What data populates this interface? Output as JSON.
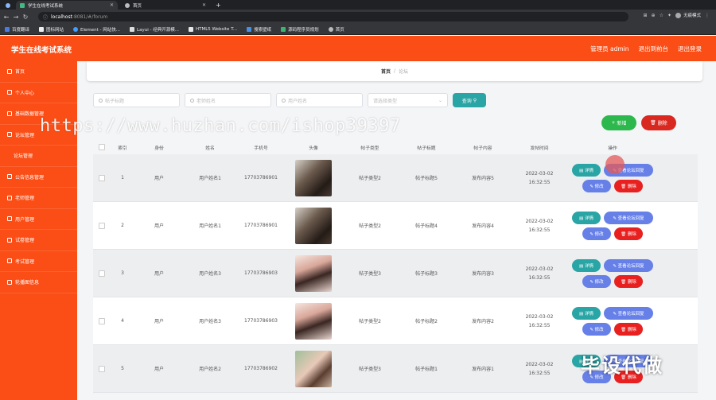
{
  "browser": {
    "tabs": [
      {
        "title": "学生在线考试系统",
        "active": true
      },
      {
        "title": "首页",
        "active": false
      }
    ],
    "url_host": "localhost",
    "url_path": ":8081/#/forum",
    "incognito_label": "无痕模式",
    "bookmarks": [
      "百度翻译",
      "图标网站",
      "Element - 网站快...",
      "Layui - 经典开源模...",
      "HTML5 Website T...",
      "搜索壁纸",
      "源码程序员规划",
      "首页"
    ]
  },
  "header": {
    "title": "学生在线考试系统",
    "links": [
      "管理员 admin",
      "退出到前台",
      "退出登录"
    ]
  },
  "sidebar": {
    "items": [
      {
        "label": "首页",
        "sub": false
      },
      {
        "label": "个人中心",
        "sub": false
      },
      {
        "label": "基础数据管理",
        "sub": false
      },
      {
        "label": "论坛管理",
        "sub": false
      },
      {
        "label": "论坛管理",
        "sub": true
      },
      {
        "label": "公告信息管理",
        "sub": false
      },
      {
        "label": "老师管理",
        "sub": false
      },
      {
        "label": "用户管理",
        "sub": false
      },
      {
        "label": "试卷管理",
        "sub": false
      },
      {
        "label": "考试管理",
        "sub": false
      },
      {
        "label": "轮播图信息",
        "sub": false
      }
    ]
  },
  "breadcrumb": {
    "home": "首页",
    "separator": "/",
    "current": "论坛"
  },
  "filters": {
    "post_title_placeholder": "帖子标题",
    "teacher_name_placeholder": "老师姓名",
    "user_name_placeholder": "用户姓名",
    "post_type_placeholder": "请选择类型",
    "search_label": "查询"
  },
  "actions": {
    "add_label": "新增",
    "delete_label": "删除"
  },
  "watermark": "https://www.huzhan.com/ishop39397",
  "bottom_watermark": "毕设代做",
  "table": {
    "columns": [
      "索引",
      "身份",
      "姓名",
      "手机号",
      "头像",
      "帖子类型",
      "帖子标题",
      "帖子内容",
      "发帖时间",
      "操作"
    ],
    "op_labels": {
      "detail": "详情",
      "view_replies": "查看论坛回复",
      "edit": "修改",
      "delete": "删除"
    },
    "rows": [
      {
        "index": "1",
        "role": "用户",
        "name": "用户姓名1",
        "phone": "17703786901",
        "avatar": "dark",
        "type": "帖子类型2",
        "title": "帖子标题5",
        "content": "发布内容5",
        "time": "2022-03-02 16:32:55"
      },
      {
        "index": "2",
        "role": "用户",
        "name": "用户姓名1",
        "phone": "17703786901",
        "avatar": "dark",
        "type": "帖子类型2",
        "title": "帖子标题4",
        "content": "发布内容4",
        "time": "2022-03-02 16:32:55"
      },
      {
        "index": "3",
        "role": "用户",
        "name": "用户姓名3",
        "phone": "17703786903",
        "avatar": "woman",
        "type": "帖子类型3",
        "title": "帖子标题3",
        "content": "发布内容3",
        "time": "2022-03-02 16:32:55"
      },
      {
        "index": "4",
        "role": "用户",
        "name": "用户姓名3",
        "phone": "17703786903",
        "avatar": "woman",
        "type": "帖子类型2",
        "title": "帖子标题2",
        "content": "发布内容2",
        "time": "2022-03-02 16:32:55"
      },
      {
        "index": "5",
        "role": "用户",
        "name": "用户姓名2",
        "phone": "17703786902",
        "avatar": "green",
        "type": "帖子类型3",
        "title": "帖子标题1",
        "content": "发布内容1",
        "time": "2022-03-02 16:32:55"
      }
    ]
  }
}
